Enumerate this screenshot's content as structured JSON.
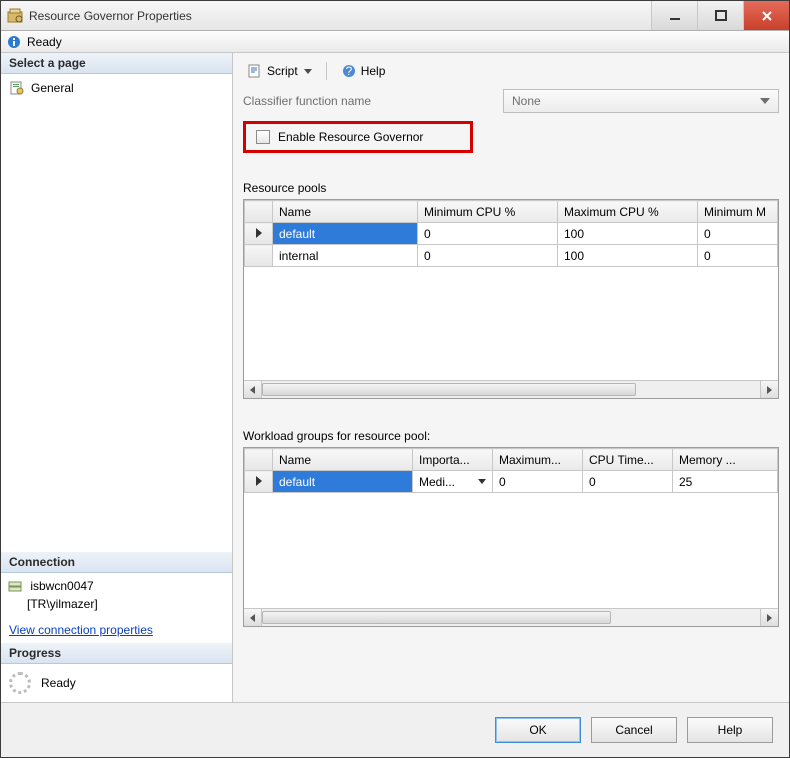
{
  "window": {
    "title": "Resource Governor Properties"
  },
  "status": {
    "text": "Ready"
  },
  "left": {
    "select_page_header": "Select a page",
    "general_label": "General",
    "connection_header": "Connection",
    "server": "isbwcn0047",
    "user": "[TR\\yilmazer]",
    "view_conn_link": "View connection properties",
    "progress_header": "Progress",
    "progress_text": "Ready"
  },
  "toolbar": {
    "script": "Script",
    "help": "Help"
  },
  "classifier": {
    "label": "Classifier function name",
    "value": "None",
    "enable_label": "Enable Resource Governor"
  },
  "pools": {
    "title": "Resource pools",
    "cols": [
      "Name",
      "Minimum CPU %",
      "Maximum CPU %",
      "Minimum M"
    ],
    "rows": [
      {
        "name": "default",
        "min_cpu": "0",
        "max_cpu": "100",
        "min_mem": "0",
        "selected": true
      },
      {
        "name": "internal",
        "min_cpu": "0",
        "max_cpu": "100",
        "min_mem": "0",
        "selected": false
      }
    ]
  },
  "groups": {
    "title": "Workload groups for resource pool:",
    "cols": [
      "Name",
      "Importa...",
      "Maximum...",
      "CPU Time...",
      "Memory ..."
    ],
    "rows": [
      {
        "name": "default",
        "importance": "Medi...",
        "max_req": "0",
        "cpu_time": "0",
        "mem": "25",
        "selected": true
      }
    ]
  },
  "buttons": {
    "ok": "OK",
    "cancel": "Cancel",
    "help": "Help"
  }
}
